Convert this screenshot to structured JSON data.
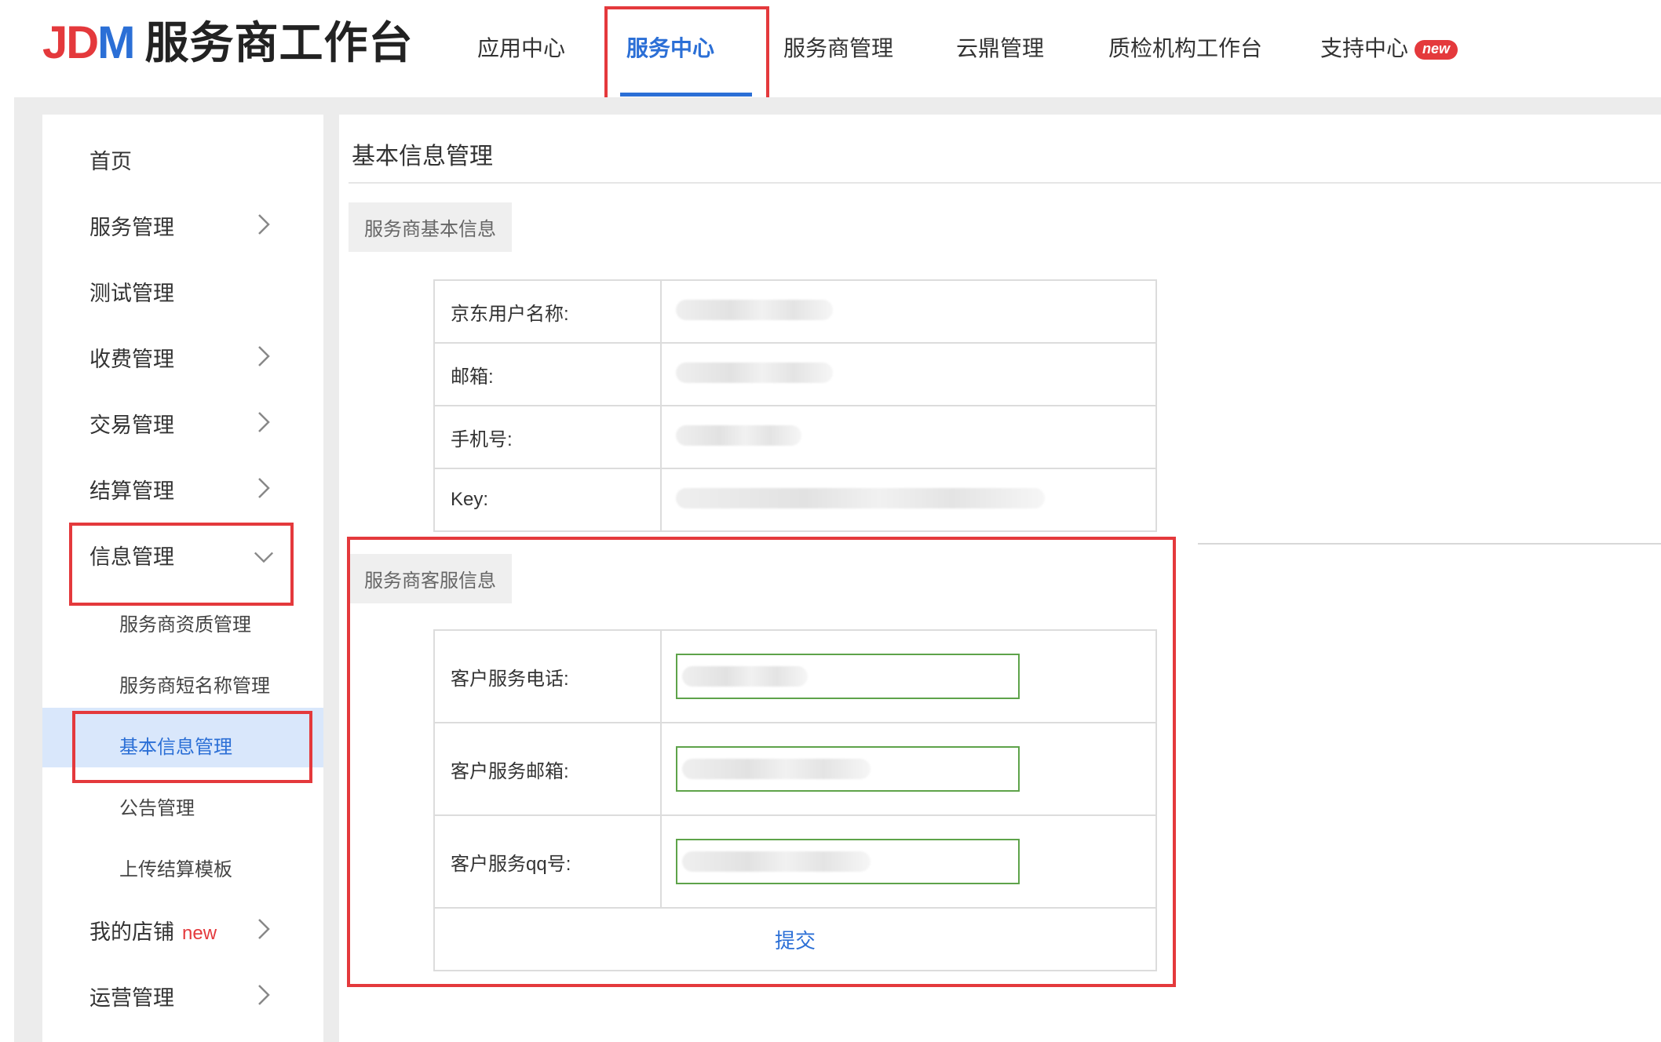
{
  "header": {
    "logo": {
      "mark_j": "J",
      "mark_d": "D",
      "mark_m": "M",
      "title": "服务商工作台"
    },
    "nav": [
      {
        "label": "应用中心"
      },
      {
        "label": "服务中心",
        "active": true
      },
      {
        "label": "服务商管理"
      },
      {
        "label": "云鼎管理"
      },
      {
        "label": "质检机构工作台"
      },
      {
        "label": "支持中心",
        "badge": "new"
      }
    ]
  },
  "sidebar": {
    "items": [
      {
        "label": "首页"
      },
      {
        "label": "服务管理"
      },
      {
        "label": "测试管理"
      },
      {
        "label": "收费管理"
      },
      {
        "label": "交易管理"
      },
      {
        "label": "结算管理"
      },
      {
        "label": "信息管理",
        "expanded": true
      }
    ],
    "sub_items": [
      {
        "label": "服务商资质管理"
      },
      {
        "label": "服务商短名称管理"
      },
      {
        "label": "基本信息管理",
        "active": true
      },
      {
        "label": "公告管理"
      },
      {
        "label": "上传结算模板"
      }
    ],
    "bottom_items": [
      {
        "label": "我的店铺",
        "badge": "new"
      },
      {
        "label": "运营管理"
      }
    ]
  },
  "main": {
    "title": "基本信息管理",
    "basic_section": {
      "tag": "服务商基本信息",
      "rows": [
        {
          "label": "京东用户名称:"
        },
        {
          "label": "邮箱:"
        },
        {
          "label": "手机号:"
        },
        {
          "label": "Key:"
        }
      ]
    },
    "service_section": {
      "tag": "服务商客服信息",
      "rows": [
        {
          "label": "客户服务电话:"
        },
        {
          "label": "客户服务邮箱:"
        },
        {
          "label": "客户服务qq号:"
        }
      ],
      "submit_label": "提交"
    }
  },
  "colors": {
    "accent": "#2b6fd6",
    "highlight": "#e4393c",
    "input_border": "#5ea34a",
    "active_menu_bg": "#d9e7fb"
  }
}
